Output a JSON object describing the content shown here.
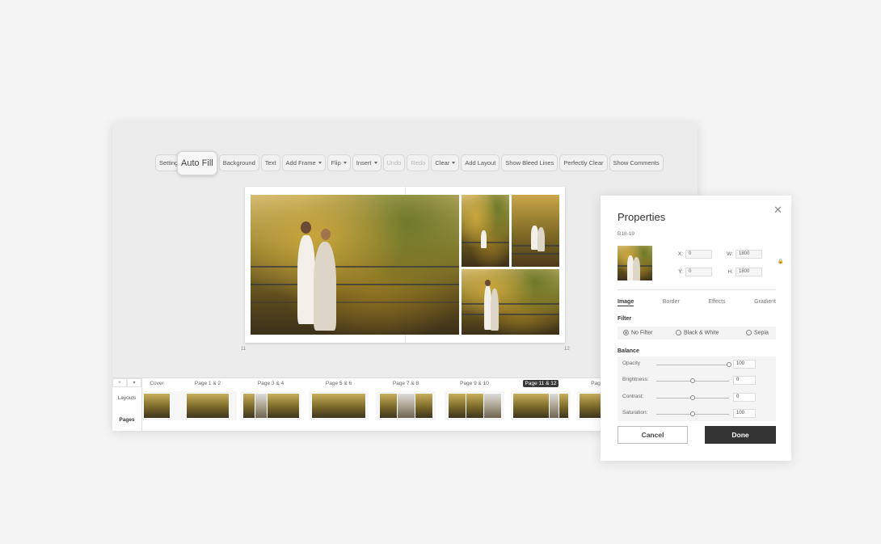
{
  "toolbar": {
    "items": [
      {
        "label": "Setting",
        "caret": false,
        "disabled": false
      },
      {
        "label": "Auto Fill",
        "caret": false,
        "disabled": false,
        "highlight": true
      },
      {
        "label": "Background",
        "caret": false,
        "disabled": false
      },
      {
        "label": "Text",
        "caret": false,
        "disabled": false
      },
      {
        "label": "Add Frame",
        "caret": true,
        "disabled": false
      },
      {
        "label": "Flip",
        "caret": true,
        "disabled": false
      },
      {
        "label": "Insert",
        "caret": true,
        "disabled": false
      },
      {
        "label": "Undo",
        "caret": false,
        "disabled": true
      },
      {
        "label": "Redo",
        "caret": false,
        "disabled": true
      },
      {
        "label": "Clear",
        "caret": true,
        "disabled": false
      },
      {
        "label": "Add Layout",
        "caret": false,
        "disabled": false
      },
      {
        "label": "Show Bleed Lines",
        "caret": false,
        "disabled": false
      },
      {
        "label": "Perfectly Clear",
        "caret": false,
        "disabled": false
      },
      {
        "label": "Show Comments",
        "caret": false,
        "disabled": false
      }
    ]
  },
  "spread": {
    "left_page_number": "11",
    "right_page_number": "12"
  },
  "strip": {
    "controls": [
      "+",
      "▾"
    ],
    "side_tabs": [
      "Layouts",
      "Pages"
    ],
    "active_side_tab": "Pages",
    "pages": [
      {
        "label": "Cover",
        "selected": false
      },
      {
        "label": "Page 1 & 2",
        "selected": false
      },
      {
        "label": "Page 3 & 4",
        "selected": false
      },
      {
        "label": "Page 5 & 6",
        "selected": false
      },
      {
        "label": "Page 7 & 8",
        "selected": false
      },
      {
        "label": "Page 9 & 10",
        "selected": false
      },
      {
        "label": "Page 11 & 12",
        "selected": true
      },
      {
        "label": "Page 13 & 14",
        "selected": false
      }
    ]
  },
  "properties": {
    "title": "Properties",
    "subtitle": "B18-19",
    "close_icon": "close-icon",
    "coords": {
      "x_label": "X:",
      "x_value": "0",
      "y_label": "Y:",
      "y_value": "0",
      "w_label": "W:",
      "w_value": "1800",
      "h_label": "H:",
      "h_value": "1800"
    },
    "tabs": [
      "Image",
      "Border",
      "Effects",
      "Gradient"
    ],
    "active_tab": "Image",
    "filter_title": "Filter",
    "filters": [
      "No Filter",
      "Black & White",
      "Sepia"
    ],
    "selected_filter": "No Filter",
    "balance_title": "Balance",
    "balance": [
      {
        "label": "Opacity",
        "value": "100",
        "level": 1.0
      },
      {
        "label": "Brightness:",
        "value": "0",
        "level": 0.5
      },
      {
        "label": "Contrast:",
        "value": "0",
        "level": 0.5
      },
      {
        "label": "Saturation:",
        "value": "100",
        "level": 0.5
      }
    ],
    "cancel_label": "Cancel",
    "done_label": "Done"
  },
  "colors": {
    "background": "#f4f4f4",
    "done_button": "#333333",
    "selected_page_badge": "#3a3a3a"
  }
}
